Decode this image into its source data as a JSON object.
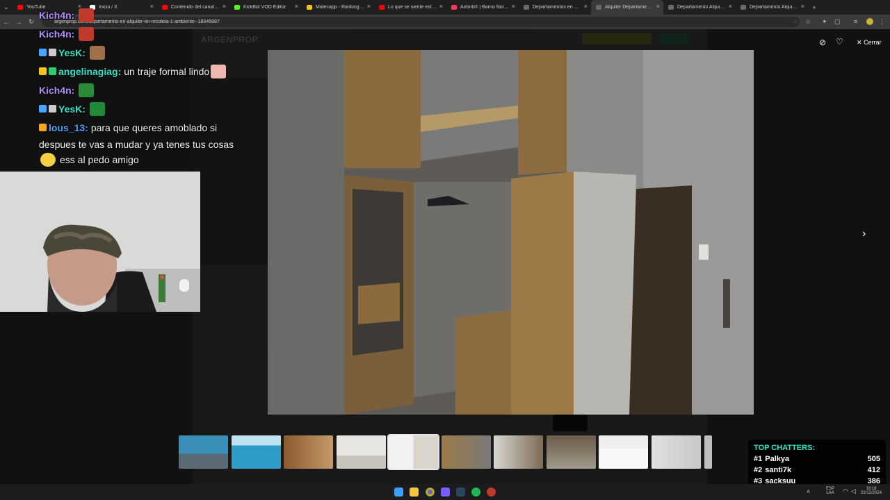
{
  "browser": {
    "tabs": [
      {
        "label": "YouTube",
        "color": "#ff0000"
      },
      {
        "label": "Inicio / X",
        "color": "#ffffff"
      },
      {
        "label": "Contenido del canal - Yo",
        "color": "#ff0000"
      },
      {
        "label": "KickBot VOD Editor",
        "color": "#53fc18"
      },
      {
        "label": "Matecapp - Ranking y Ra",
        "color": "#f5c518"
      },
      {
        "label": "Lo que se siente estar sol",
        "color": "#ff0000"
      },
      {
        "label": "Airbnb® | Barrio Norte, R",
        "color": "#ff385c"
      },
      {
        "label": "Departamentos en Alquil",
        "color": "#6a6a6a"
      },
      {
        "label": "Alquiler Departamento a",
        "color": "#6a6a6a"
      },
      {
        "label": "Departamento Alquiler 8",
        "color": "#6a6a6a"
      },
      {
        "label": "Departamento Alquiler 8",
        "color": "#6a6a6a"
      }
    ],
    "active_tab_index": 8,
    "url": "argenprop.com/departamento-en-alquiler-en-recoleta-1-ambiente--18646887"
  },
  "site": {
    "logo": "ARGENPROP",
    "close_label": "Cerrar"
  },
  "chat": [
    {
      "user": "Kich4n:",
      "color": "#b48cff",
      "text": "",
      "emote": "#c0392b"
    },
    {
      "user": "Kich4n:",
      "color": "#b48cff",
      "text": "",
      "emote": "#c0392b"
    },
    {
      "user": "YesK:",
      "color": "#2ee6c8",
      "text": "",
      "emote": "#a0704a",
      "badges": [
        "#4aa3ff",
        "#cccccc"
      ]
    },
    {
      "user": "angelinagiag:",
      "color": "#2ee6c8",
      "text": "un traje formal lindo",
      "emote": "#f0b7b0",
      "badges": [
        "#f5c518",
        "#2ecc71"
      ]
    },
    {
      "user": "Kich4n:",
      "color": "#b48cff",
      "text": "",
      "emote": "#2a8a3a"
    },
    {
      "user": "YesK:",
      "color": "#2ee6c8",
      "text": "",
      "emote": "#1e8a3a",
      "badges": [
        "#4aa3ff",
        "#cccccc"
      ]
    },
    {
      "user": "lous_13:",
      "color": "#4aa3ff",
      "text": "para que queres amoblado si",
      "badges": [
        "#f5a623"
      ]
    },
    {
      "user": "",
      "color": "#ffffff",
      "text": "despues te vas a mudar y ya tenes tus cosas"
    },
    {
      "user": "",
      "color": "#ffffff",
      "text": "ess al pedo amigo",
      "emote_before": "#f5d142"
    }
  ],
  "top_chatters": {
    "title": "TOP CHATTERS:",
    "rows": [
      {
        "rank": "#1",
        "name": "Palkya",
        "count": "505"
      },
      {
        "rank": "#2",
        "name": "santi7k",
        "count": "412"
      },
      {
        "rank": "#3",
        "name": "sacksuu",
        "count": "386"
      }
    ]
  },
  "taskbar": {
    "lang": "ESP",
    "lang2": "LAA",
    "time": "18:18",
    "date": "22/12/2024"
  }
}
